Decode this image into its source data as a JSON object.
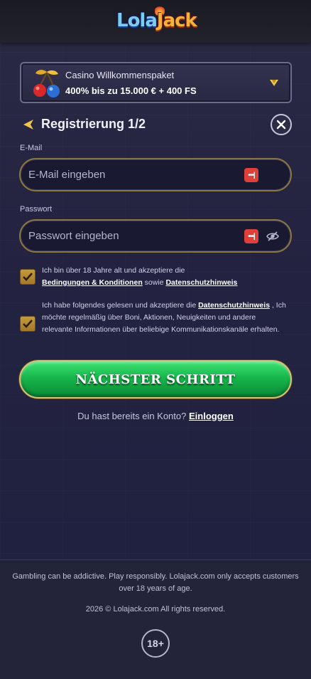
{
  "brand": {
    "logo_main": "Lola",
    "logo_accent": "Jack"
  },
  "promo": {
    "title": "Casino Willkommenspaket",
    "subtitle": "400% bis zu 15.000 € + 400 FS",
    "icon": "cherries-icon"
  },
  "registration": {
    "title": "Registrierung 1/2"
  },
  "form": {
    "email_label": "E-Mail",
    "email_placeholder": "E-Mail eingeben",
    "password_label": "Passwort",
    "password_placeholder": "Passwort eingeben",
    "password_manager_badge": "•••|"
  },
  "consents": [
    {
      "checked": true,
      "text_1": "Ich bin über 18 Jahre alt und akzeptiere die",
      "link_1": "Bedingungen & Konditionen",
      "text_2": "sowie",
      "link_2": "Datenschutzhinweis"
    },
    {
      "checked": true,
      "text_1": "Ich habe folgendes gelesen und akzeptiere die",
      "link_1": "Datenschutzhinweis",
      "text_2": ", Ich möchte regelmäßig über Boni, Aktionen, Neuigkeiten und andere relevante Informationen über beliebige Kommunikationskanäle erhalten."
    }
  ],
  "actions": {
    "next_label": "NÄCHSTER SCHRITT",
    "login_prompt": "Du hast bereits ein Konto?",
    "login_link": "Einloggen"
  },
  "footer": {
    "disclaimer": "Gambling can be addictive. Play responsibly. Lolajack.com only accepts customers over 18 years of age.",
    "copyright": "2026 © Lolajack.com All rights reserved.",
    "age_badge": "18+"
  },
  "colors": {
    "accent_gold": "#c59b3a",
    "cta_green": "#16b64b",
    "background": "#232341"
  }
}
